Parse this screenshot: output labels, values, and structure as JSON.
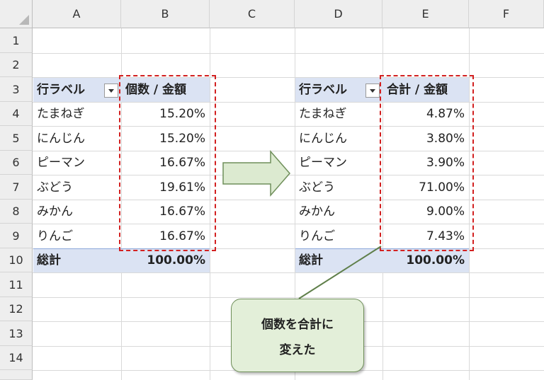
{
  "columns": [
    "A",
    "B",
    "C",
    "D",
    "E",
    "F"
  ],
  "rows": [
    "1",
    "2",
    "3",
    "4",
    "5",
    "6",
    "7",
    "8",
    "9",
    "10",
    "11",
    "12",
    "13",
    "14"
  ],
  "pivot_left": {
    "header_label": "行ラベル",
    "header_value": "個数 / 金額",
    "items": [
      {
        "label": "たまねぎ",
        "value": "15.20%"
      },
      {
        "label": "にんじん",
        "value": "15.20%"
      },
      {
        "label": "ピーマン",
        "value": "16.67%"
      },
      {
        "label": "ぶどう",
        "value": "19.61%"
      },
      {
        "label": "みかん",
        "value": "16.67%"
      },
      {
        "label": "りんご",
        "value": "16.67%"
      }
    ],
    "total_label": "総計",
    "total_value": "100.00%"
  },
  "pivot_right": {
    "header_label": "行ラベル",
    "header_value": "合計 / 金額",
    "items": [
      {
        "label": "たまねぎ",
        "value": "4.87%"
      },
      {
        "label": "にんじん",
        "value": "3.80%"
      },
      {
        "label": "ピーマン",
        "value": "3.90%"
      },
      {
        "label": "ぶどう",
        "value": "71.00%"
      },
      {
        "label": "みかん",
        "value": "9.00%"
      },
      {
        "label": "りんご",
        "value": "7.43%"
      }
    ],
    "total_label": "総計",
    "total_value": "100.00%"
  },
  "callout": {
    "line1": "個数を合計に",
    "line2": "変えた"
  },
  "colors": {
    "header_fill": "#dbe3f3",
    "dashed_border": "#d22020",
    "arrow_fill": "#dcead0",
    "callout_fill": "#e3efd9"
  },
  "icons": {
    "arrow": "right-arrow-icon",
    "filter": "filter-dropdown-icon"
  }
}
